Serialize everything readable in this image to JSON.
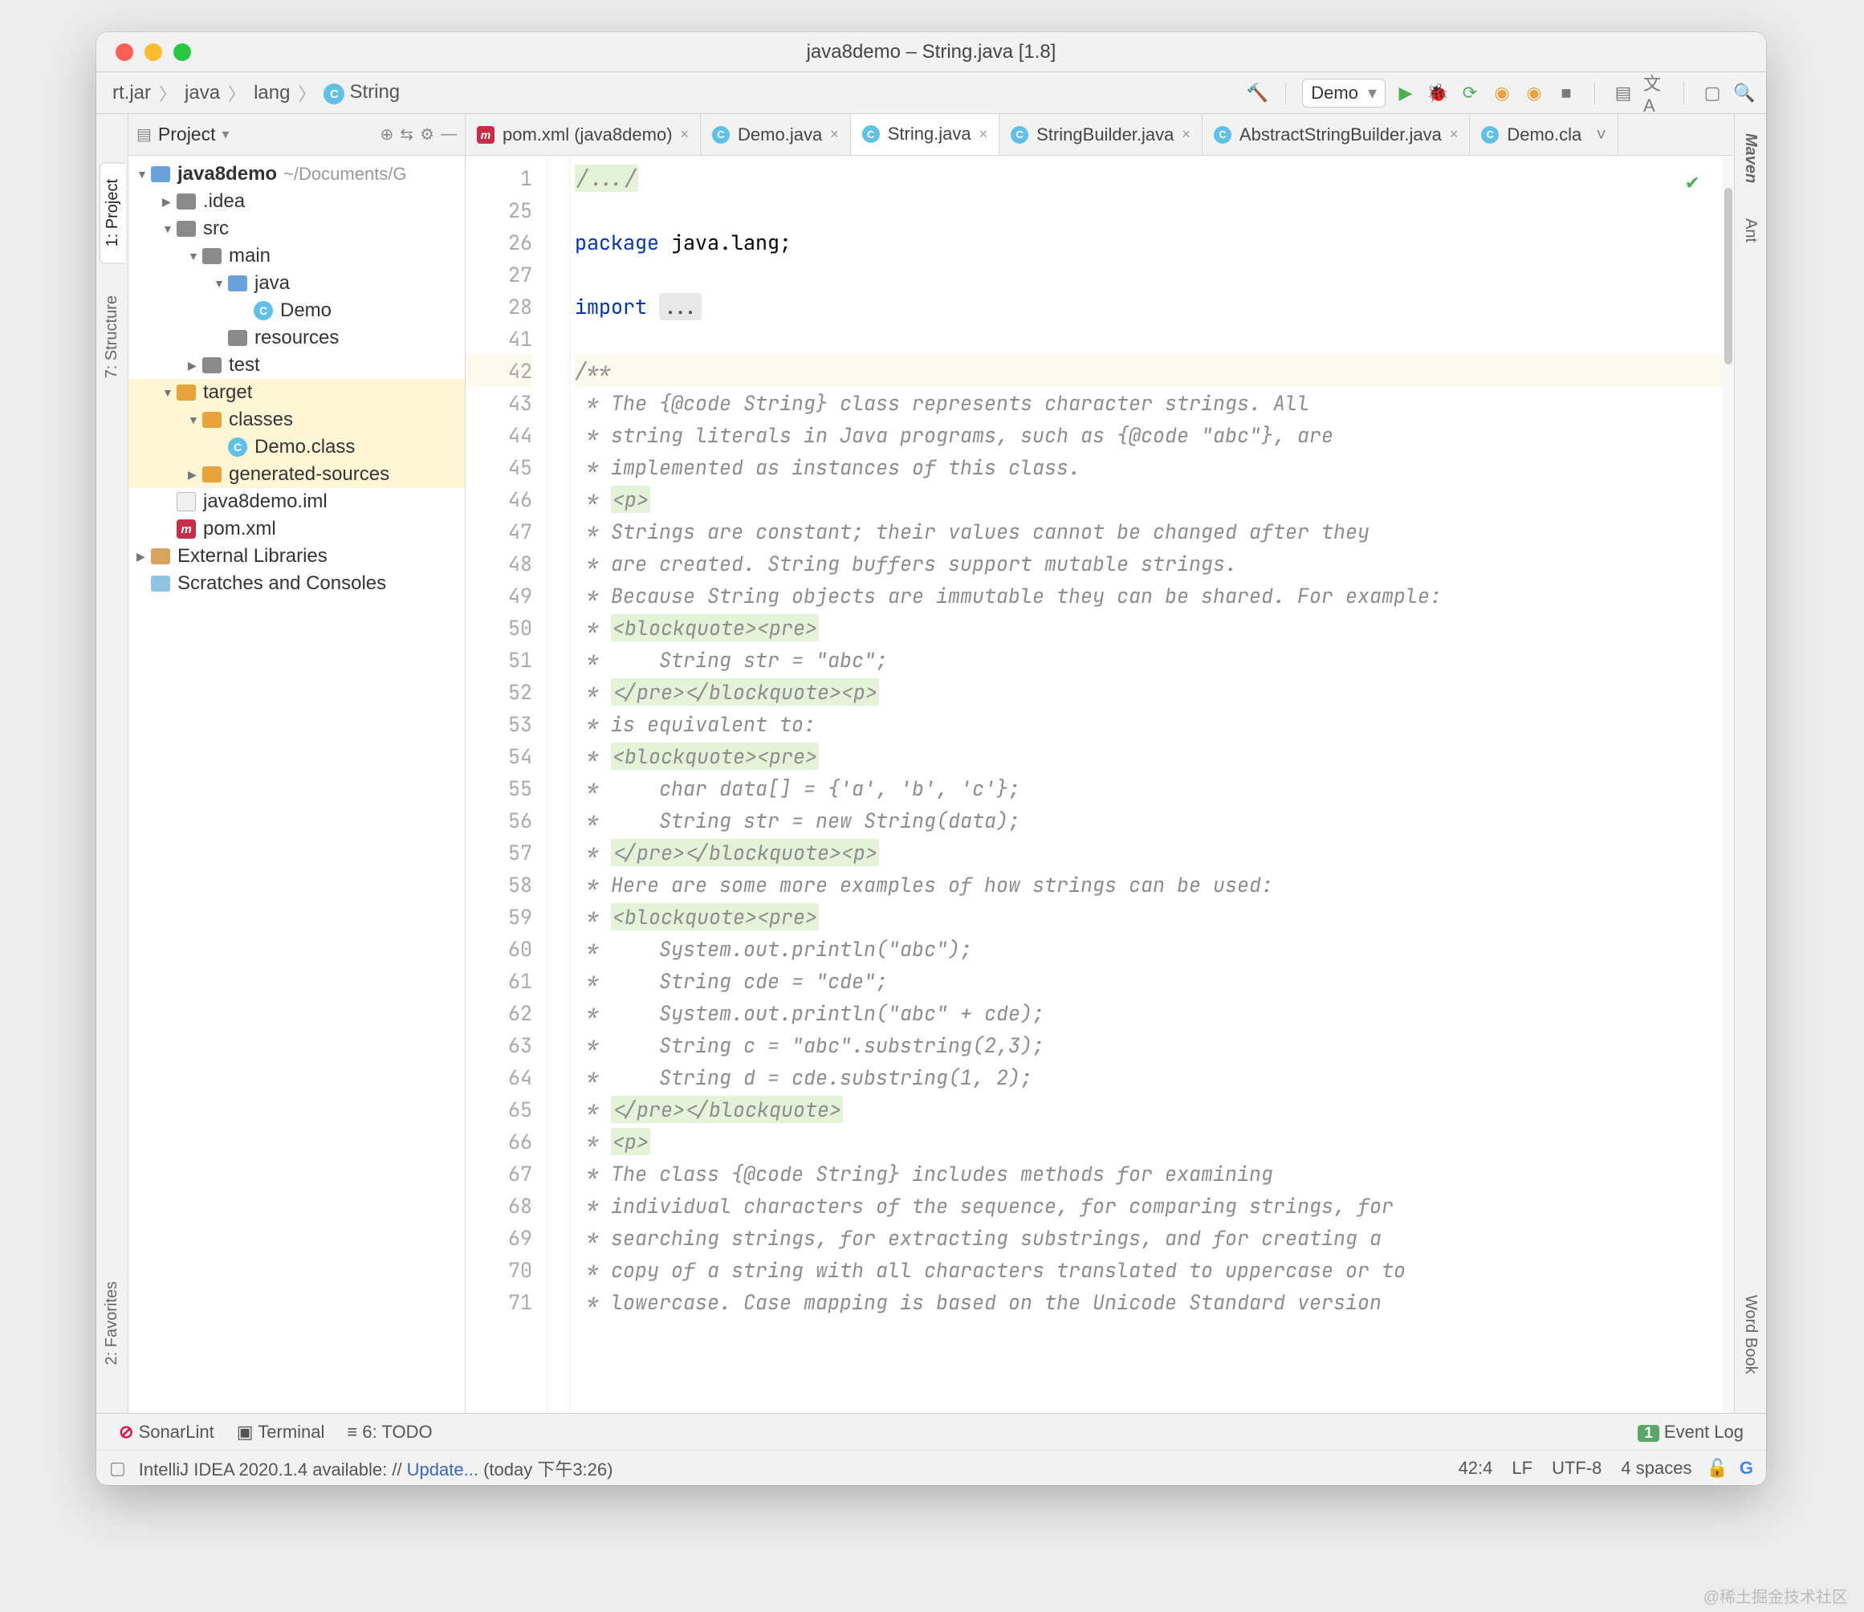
{
  "window_title": "java8demo – String.java [1.8]",
  "breadcrumbs": [
    "rt.jar",
    "java",
    "lang",
    "String"
  ],
  "run_config": "Demo",
  "sidebar_left": [
    "1: Project",
    "7: Structure",
    "2: Favorites"
  ],
  "sidebar_right": [
    "Maven",
    "Ant",
    "Word Book"
  ],
  "project_panel": {
    "title": "Project"
  },
  "tree": {
    "root": {
      "name": "java8demo",
      "path": "~/Documents/G"
    },
    "idea": ".idea",
    "src": "src",
    "main": "main",
    "java": "java",
    "demo": "Demo",
    "resources": "resources",
    "test": "test",
    "target": "target",
    "classes": "classes",
    "demoClass": "Demo.class",
    "gensrc": "generated-sources",
    "iml": "java8demo.iml",
    "pom": "pom.xml",
    "ext": "External Libraries",
    "scratch": "Scratches and Consoles"
  },
  "editor_tabs": [
    {
      "label": "pom.xml (java8demo)",
      "kind": "m"
    },
    {
      "label": "Demo.java",
      "kind": "c"
    },
    {
      "label": "String.java",
      "kind": "c",
      "active": true
    },
    {
      "label": "StringBuilder.java",
      "kind": "c"
    },
    {
      "label": "AbstractStringBuilder.java",
      "kind": "c"
    },
    {
      "label": "Demo.cla",
      "kind": "c"
    }
  ],
  "gutter": [
    "1",
    "25",
    "26",
    "27",
    "28",
    "41",
    "42",
    "43",
    "44",
    "45",
    "46",
    "47",
    "48",
    "49",
    "50",
    "51",
    "52",
    "53",
    "54",
    "55",
    "56",
    "57",
    "58",
    "59",
    "60",
    "61",
    "62",
    "63",
    "64",
    "65",
    "66",
    "67",
    "68",
    "69",
    "70",
    "71"
  ],
  "code": {
    "l1": "/.../",
    "l26a": "package",
    "l26b": " java.lang;",
    "l28a": "import ",
    "l28b": "...",
    "l42": "/**",
    "l43": " * The {@code String} class represents character strings. All",
    "l44": " * string literals in Java programs, such as {@code \"abc\"}, are",
    "l45": " * implemented as instances of this class.",
    "l46": " * <p>",
    "l47": " * Strings are constant; their values cannot be changed after they",
    "l48": " * are created. String buffers support mutable strings.",
    "l49": " * Because String objects are immutable they can be shared. For example:",
    "l50": " * <blockquote><pre>",
    "l51": " *     String str = \"abc\";",
    "l52": " * </pre></blockquote><p>",
    "l53": " * is equivalent to:",
    "l54": " * <blockquote><pre>",
    "l55": " *     char data[] = {'a', 'b', 'c'};",
    "l56": " *     String str = new String(data);",
    "l57": " * </pre></blockquote><p>",
    "l58": " * Here are some more examples of how strings can be used:",
    "l59": " * <blockquote><pre>",
    "l60": " *     System.out.println(\"abc\");",
    "l61": " *     String cde = \"cde\";",
    "l62": " *     System.out.println(\"abc\" + cde);",
    "l63": " *     String c = \"abc\".substring(2,3);",
    "l64": " *     String d = cde.substring(1, 2);",
    "l65": " * </pre></blockquote>",
    "l66": " * <p>",
    "l67": " * The class {@code String} includes methods for examining",
    "l68": " * individual characters of the sequence, for comparing strings, for",
    "l69": " * searching strings, for extracting substrings, and for creating a",
    "l70": " * copy of a string with all characters translated to uppercase or to",
    "l71": " * lowercase. Case mapping is based on the Unicode Standard version"
  },
  "bottom_tools": [
    "SonarLint",
    "Terminal",
    "6: TODO"
  ],
  "event_log": "Event Log",
  "status": {
    "msg_a": "IntelliJ IDEA 2020.1.4 available: // ",
    "msg_link": "Update...",
    "msg_b": " (today 下午3:26)",
    "pos": "42:4",
    "lf": "LF",
    "enc": "UTF-8",
    "indent": "4 spaces"
  },
  "watermark": "@稀土掘金技术社区"
}
